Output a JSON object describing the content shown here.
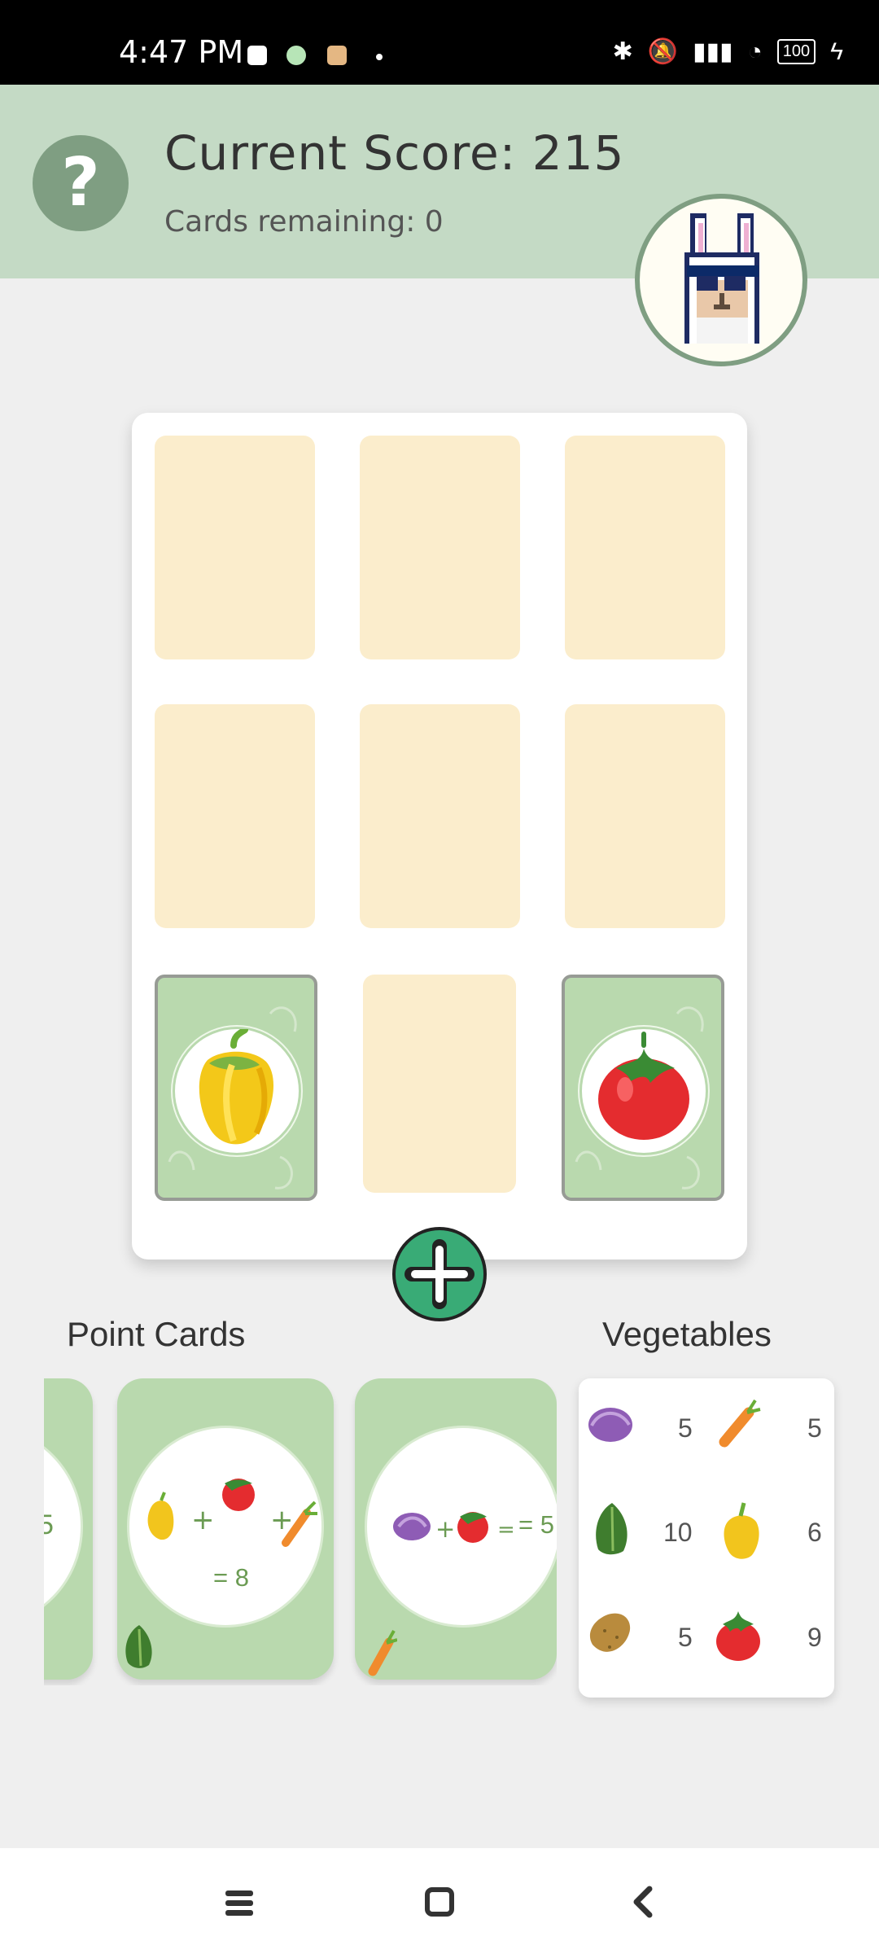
{
  "status": {
    "time": "4:47 PM",
    "battery": "100"
  },
  "header": {
    "score_label": "Current Score: 215",
    "remaining_label": "Cards remaining: 0"
  },
  "board": {
    "cards": [
      "empty",
      "empty",
      "empty",
      "empty",
      "empty",
      "empty",
      "yellow-pepper",
      "empty",
      "tomato"
    ]
  },
  "sections": {
    "point_cards": "Point Cards",
    "vegetables": "Vegetables"
  },
  "point_cards": [
    {
      "edge_text": "5"
    },
    {
      "formula": "= 8",
      "items": [
        "yellow-pepper",
        "tomato",
        "carrot"
      ],
      "corner": "lettuce"
    },
    {
      "formula": "= 5",
      "items": [
        "red-cabbage",
        "tomato"
      ],
      "corner": "carrot"
    }
  ],
  "vegetables": [
    {
      "left_icon": "red-cabbage-icon",
      "left_value": "5",
      "right_icon": "carrot-icon",
      "right_value": "5"
    },
    {
      "left_icon": "lettuce-icon",
      "left_value": "10",
      "right_icon": "yellow-pepper-icon",
      "right_value": "6"
    },
    {
      "left_icon": "potato-icon",
      "left_value": "5",
      "right_icon": "tomato-icon",
      "right_value": "9"
    }
  ],
  "colors": {
    "header": "#c4dac5",
    "help_button": "#7f9e82",
    "empty_slot": "#fbedcc",
    "card_green": "#b9d9ae",
    "add_button": "#39ab76"
  }
}
